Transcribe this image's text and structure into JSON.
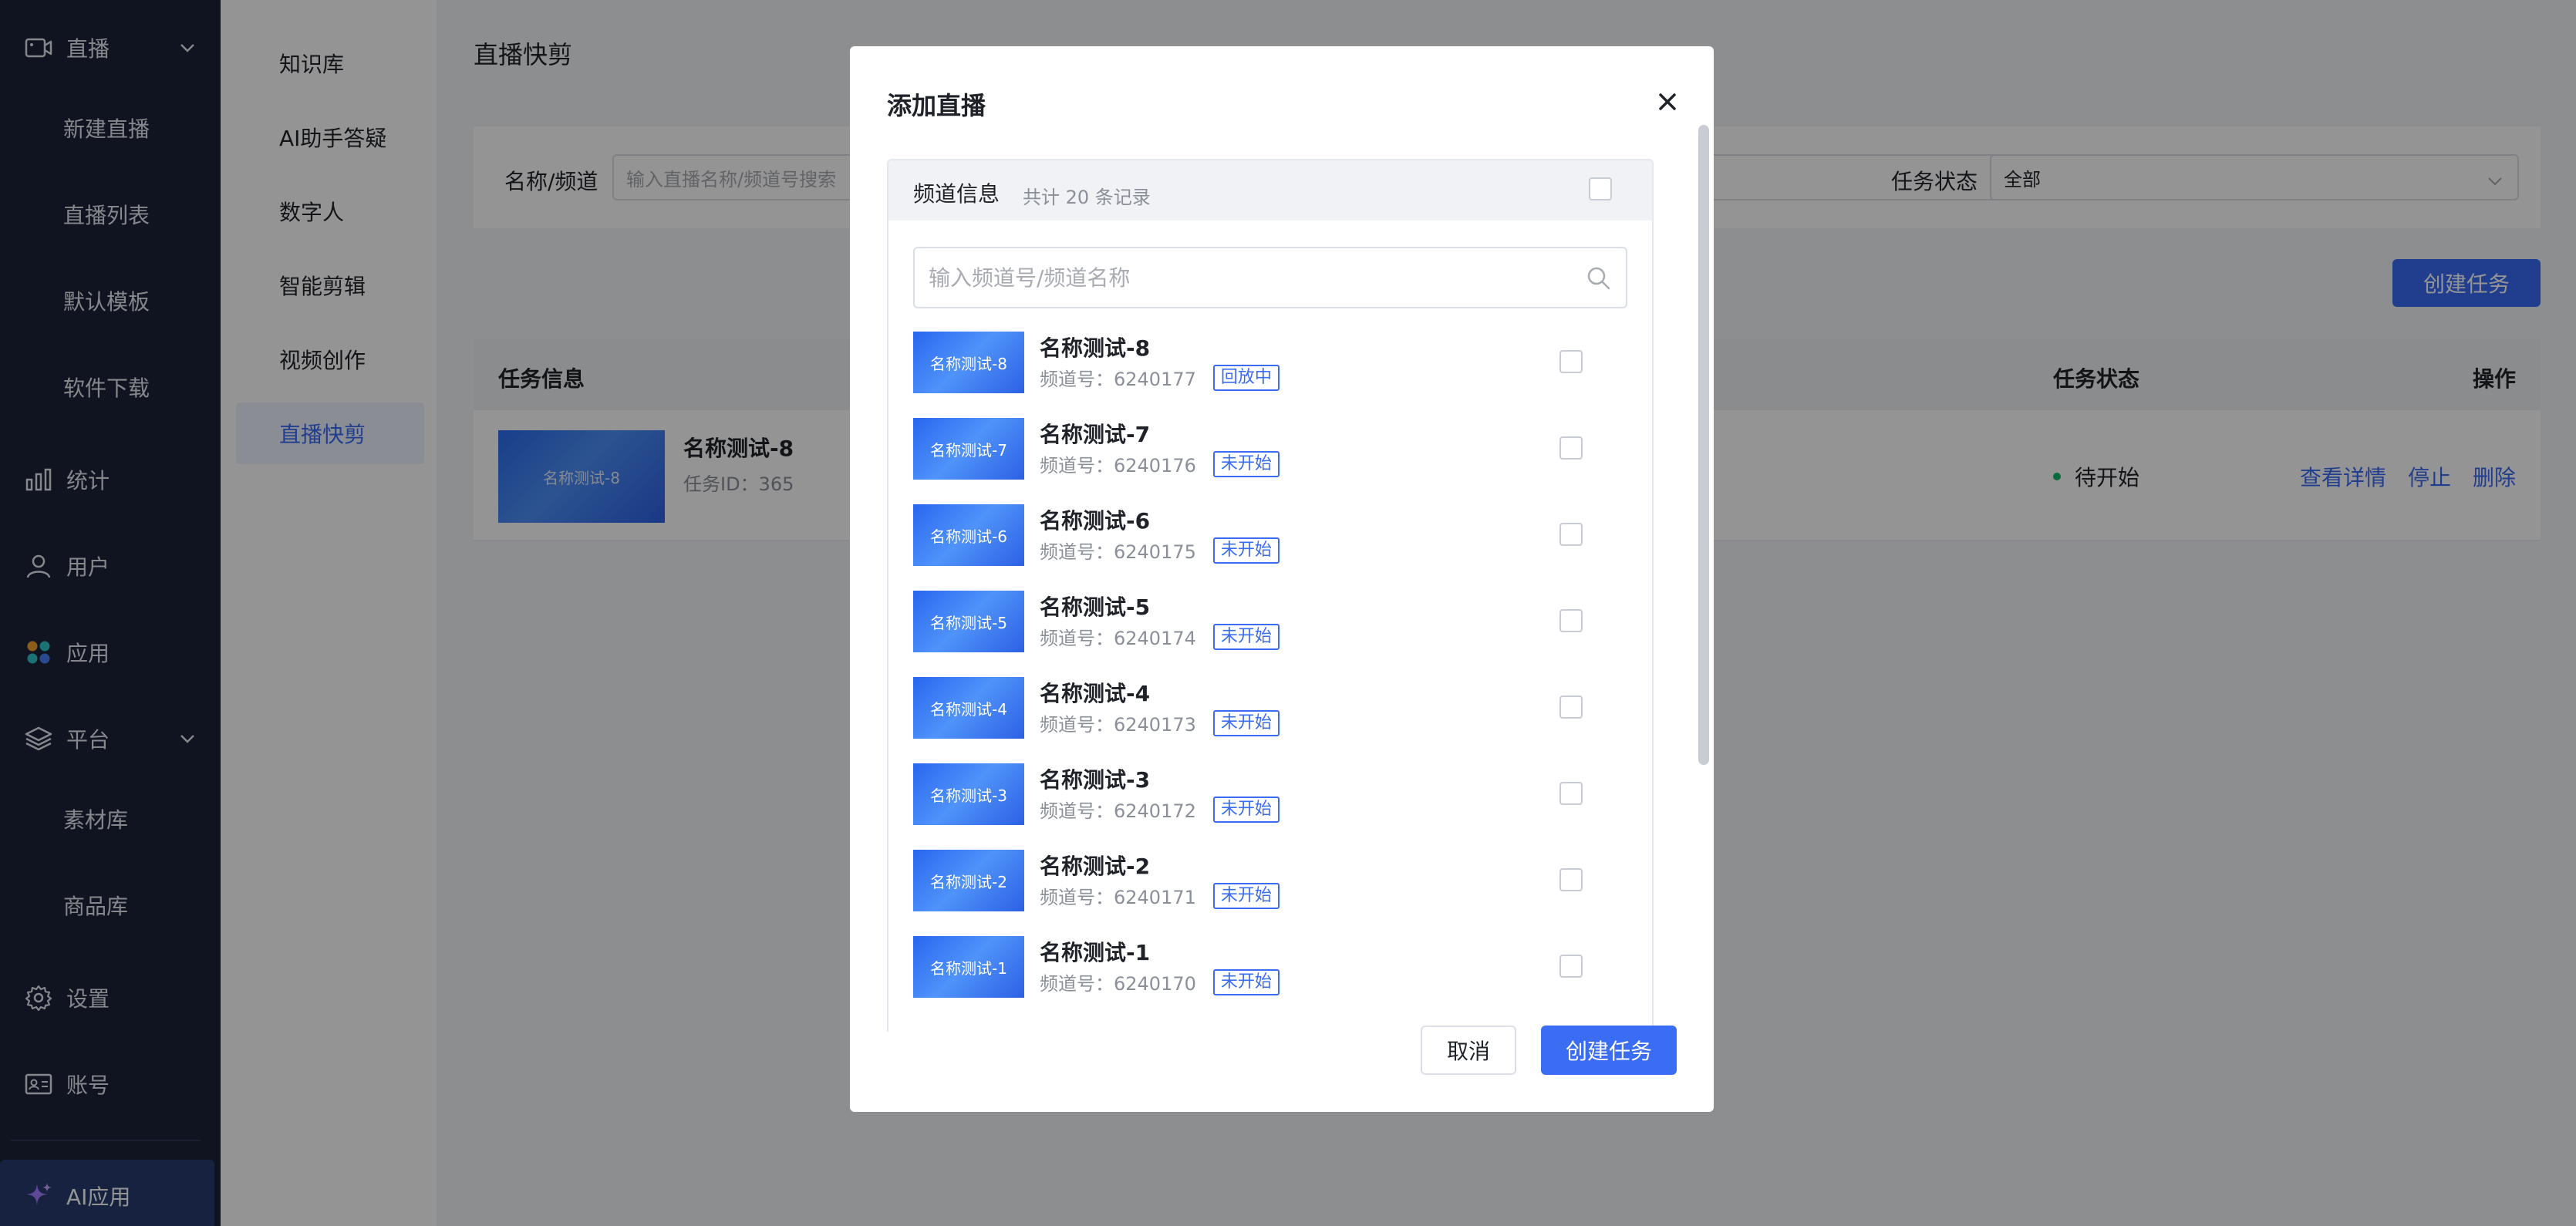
{
  "sidebar": {
    "live": {
      "label": "直播",
      "icon": "video-camera-icon"
    },
    "live_children": [
      "新建直播",
      "直播列表",
      "默认模板",
      "软件下载"
    ],
    "stats": {
      "label": "统计",
      "icon": "bar-chart-icon"
    },
    "users": {
      "label": "用户",
      "icon": "user-icon"
    },
    "apps": {
      "label": "应用",
      "icon": "apps-grid-icon"
    },
    "platform": {
      "label": "平台",
      "icon": "layers-icon"
    },
    "platform_children": [
      "素材库",
      "商品库"
    ],
    "settings": {
      "label": "设置",
      "icon": "gear-icon"
    },
    "account": {
      "label": "账号",
      "icon": "id-card-icon"
    },
    "ai_apps": {
      "label": "AI应用",
      "icon": "sparkle-icon"
    }
  },
  "sub_sidebar": {
    "items": [
      "知识库",
      "AI助手答疑",
      "数字人",
      "智能剪辑",
      "视频创作",
      "直播快剪"
    ],
    "active_index": 5
  },
  "main": {
    "page_title": "直播快剪",
    "filter": {
      "name_label": "名称/频道",
      "name_placeholder": "输入直播名称/频道号搜索",
      "status_label": "任务状态",
      "status_value": "全部"
    },
    "create_button": "创建任务",
    "table": {
      "headers": {
        "info": "任务信息",
        "status": "任务状态",
        "actions": "操作"
      },
      "rows": [
        {
          "thumb_text": "名称测试-8",
          "name": "名称测试-8",
          "task_id": "任务ID：365",
          "status": "待开始",
          "actions": [
            "查看详情",
            "停止",
            "删除"
          ]
        }
      ]
    }
  },
  "modal": {
    "title": "添加直播",
    "panel_title": "频道信息",
    "panel_count": "共计 20 条记录",
    "search_placeholder": "输入频道号/频道名称",
    "channels": [
      {
        "thumb_text": "名称测试-8",
        "name": "名称测试-8",
        "channel": "频道号：6240177",
        "status": "回放中"
      },
      {
        "thumb_text": "名称测试-7",
        "name": "名称测试-7",
        "channel": "频道号：6240176",
        "status": "未开始"
      },
      {
        "thumb_text": "名称测试-6",
        "name": "名称测试-6",
        "channel": "频道号：6240175",
        "status": "未开始"
      },
      {
        "thumb_text": "名称测试-5",
        "name": "名称测试-5",
        "channel": "频道号：6240174",
        "status": "未开始"
      },
      {
        "thumb_text": "名称测试-4",
        "name": "名称测试-4",
        "channel": "频道号：6240173",
        "status": "未开始"
      },
      {
        "thumb_text": "名称测试-3",
        "name": "名称测试-3",
        "channel": "频道号：6240172",
        "status": "未开始"
      },
      {
        "thumb_text": "名称测试-2",
        "name": "名称测试-2",
        "channel": "频道号：6240171",
        "status": "未开始"
      },
      {
        "thumb_text": "名称测试-1",
        "name": "名称测试-1",
        "channel": "频道号：6240170",
        "status": "未开始"
      }
    ],
    "cancel_button": "取消",
    "create_button": "创建任务"
  },
  "colors": {
    "accent": "#3a6cf4",
    "sidebar_bg": "#1a2437",
    "status_dot": "#18b566"
  }
}
